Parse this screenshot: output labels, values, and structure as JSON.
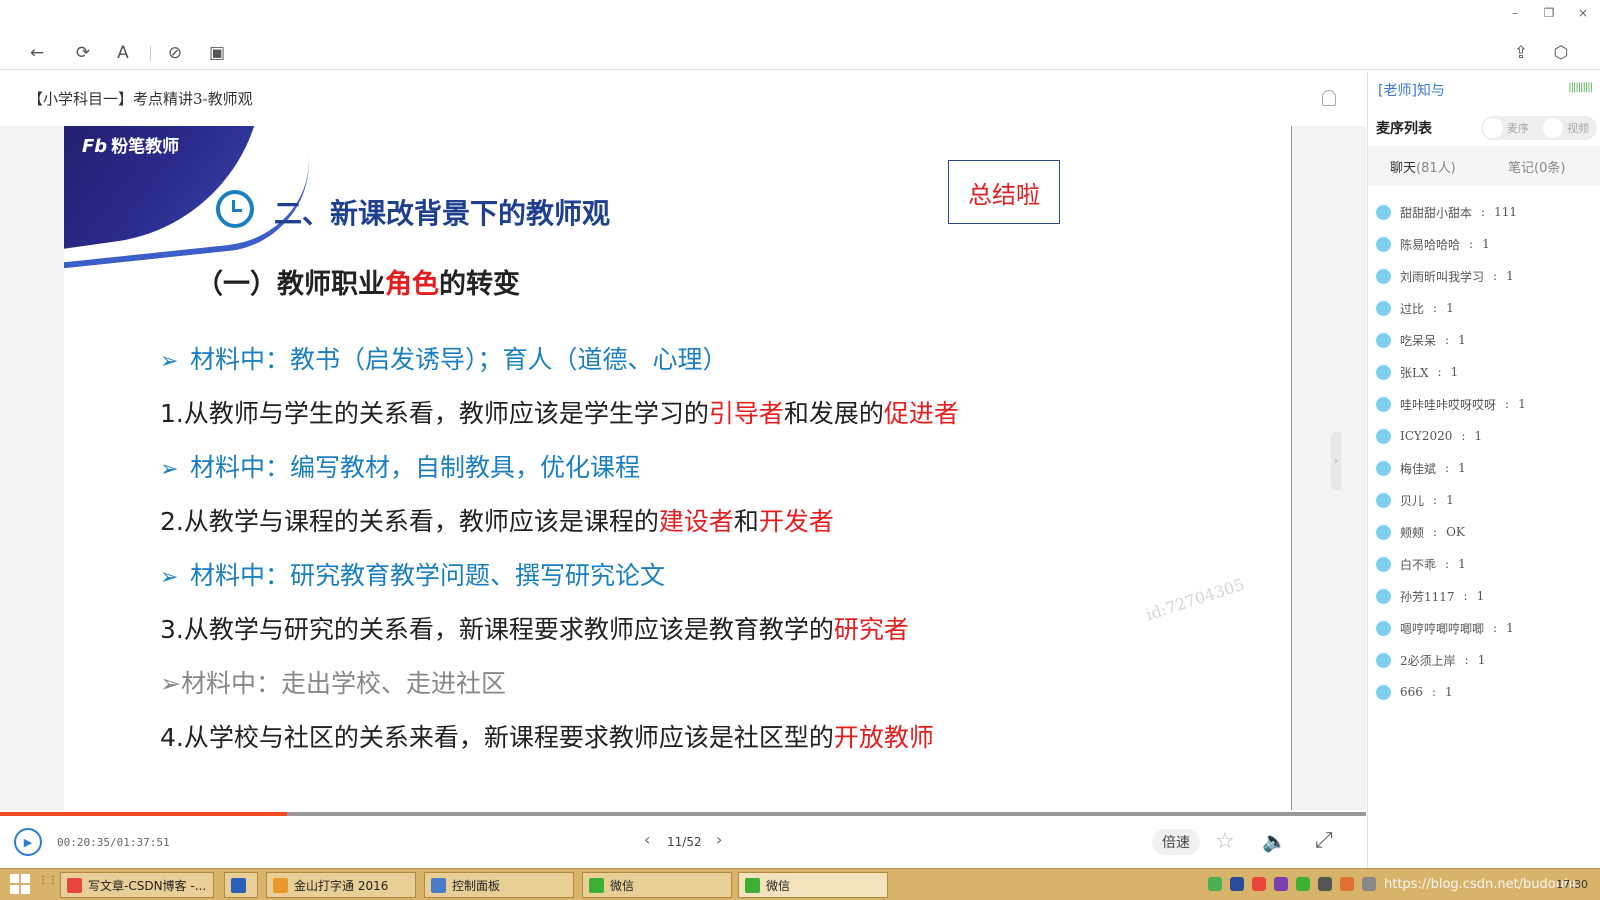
{
  "window": {
    "minimize": "–",
    "restore": "❐",
    "close": "×"
  },
  "toolbar": {
    "back": "←",
    "refresh": "⟳",
    "font": "A",
    "link": "⊘",
    "layout": "▣",
    "share": "⇪",
    "cube": "⬡"
  },
  "course_title": "【小学科目一】考点精讲3-教师观",
  "slide": {
    "brand": "粉笔教师",
    "brand_mark": "Fb",
    "title": "二、新课改背景下的教师观",
    "summary": "总结啦",
    "subtitle": {
      "a": "（一）教师职业",
      "b": "角色",
      "c": "的转变"
    },
    "arrow": "➢",
    "lines": [
      {
        "kind": "mat",
        "text": "材料中：教书（启发诱导）；育人（道德、心理）"
      },
      {
        "kind": "pt",
        "a": "1.从教师与学生的关系看，教师应该是学生学习的",
        "b": "引导者",
        "c": "和发展的",
        "d": "促进者"
      },
      {
        "kind": "mat",
        "text": "材料中：编写教材，自制教具，优化课程"
      },
      {
        "kind": "pt",
        "a": "2.从教学与课程的关系看，教师应该是课程的",
        "b": "建设者",
        "c": "和",
        "d": "开发者"
      },
      {
        "kind": "mat",
        "text": "材料中：研究教育教学问题、撰写研究论文"
      },
      {
        "kind": "pt",
        "a": "3.从教学与研究的关系看，新课程要求教师应该是教育教学的",
        "b": "研究者"
      },
      {
        "kind": "mat-grey",
        "text": "材料中：走出学校、走进社区"
      },
      {
        "kind": "pt",
        "a": "4.从学校与社区的关系来看，新课程要求教师应该是社区型的",
        "b": "开放教师"
      }
    ],
    "watermark": "id:72704305"
  },
  "player": {
    "progress_fraction": 0.21,
    "time": "00:20:35/01:37:51",
    "page": "11/52",
    "speed": "倍速"
  },
  "panel": {
    "teacher": "[老师]知与",
    "queue_title": "麦序列表",
    "queue_mic": "麦序",
    "queue_video": "视频",
    "tab_chat": "聊天",
    "tab_chat_count": "(81人)",
    "tab_notes": "笔记(0条)",
    "messages": [
      {
        "user": "甜甜甜小甜本",
        "text": "111"
      },
      {
        "user": "陈易哈哈哈",
        "text": "1"
      },
      {
        "user": "刘雨昕叫我学习",
        "text": "1"
      },
      {
        "user": "过比",
        "text": "1"
      },
      {
        "user": "吃呆呆",
        "text": "1"
      },
      {
        "user": "张LX",
        "text": "1"
      },
      {
        "user": "哇咔哇咔哎呀哎呀",
        "text": "1"
      },
      {
        "user": "ICY2020",
        "text": "1"
      },
      {
        "user": "梅佳斌",
        "text": "1"
      },
      {
        "user": "贝儿",
        "text": "1"
      },
      {
        "user": "颊颊",
        "text": "OK"
      },
      {
        "user": "白不乖",
        "text": "1"
      },
      {
        "user": "孙芳1117",
        "text": "1"
      },
      {
        "user": "嗯哼哼唧哼唧唧",
        "text": "1"
      },
      {
        "user": "2必须上岸",
        "text": "1"
      },
      {
        "user": "666",
        "text": "1"
      }
    ]
  },
  "taskbar": {
    "items": [
      {
        "label": "写文章-CSDN博客 -...",
        "color": "#e8453c"
      },
      {
        "label": "",
        "color": "#2b5eb8"
      },
      {
        "label": "金山打字通 2016",
        "color": "#e89a2c"
      },
      {
        "label": "控制面板",
        "color": "#4a7cc9"
      },
      {
        "label": "微信",
        "color": "#3cb034"
      },
      {
        "label": "微信",
        "color": "#3cb034"
      }
    ],
    "tray_text": "https://blog.csdn.net/budouhu",
    "clock": "17:30"
  }
}
